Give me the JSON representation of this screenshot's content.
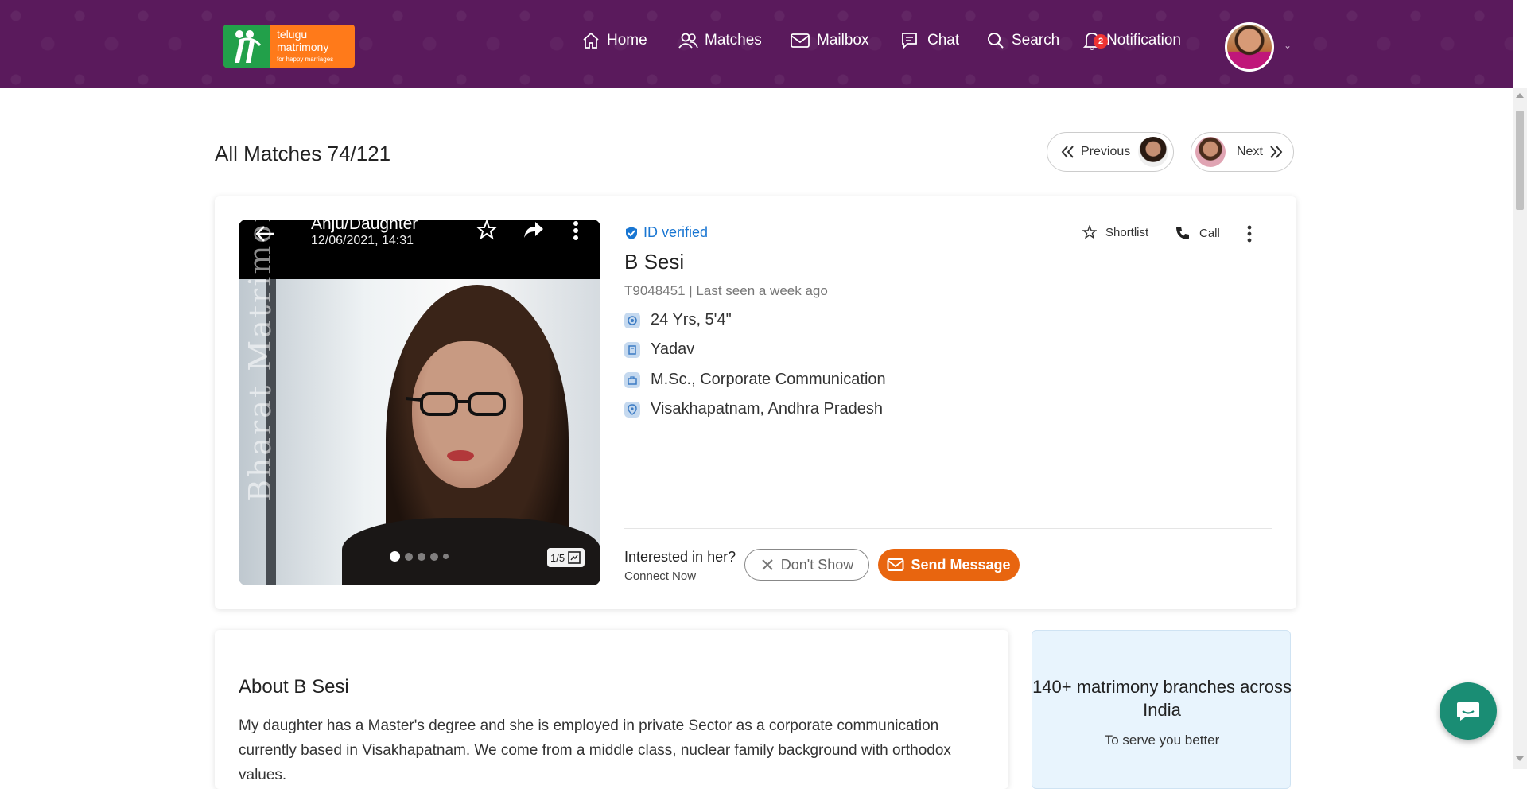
{
  "brand": {
    "line1": "telugu",
    "line2": "matrimony",
    "tagline": "for happy marriages"
  },
  "nav": {
    "home": "Home",
    "matches": "Matches",
    "mailbox": "Mailbox",
    "chat": "Chat",
    "search": "Search",
    "notification": "Notification",
    "notification_count": "2"
  },
  "page": {
    "title": "All Matches 74/121",
    "previous_label": "Previous",
    "next_label": "Next"
  },
  "profile": {
    "photo_title": "Anju/Daughter",
    "photo_date": "12/06/2021, 14:31",
    "watermark": "Bharat Matrimony.com",
    "photo_counter": "1/5",
    "verified_label": "ID verified",
    "name": "B Sesi",
    "meta": "T9048451 | Last seen a week ago",
    "age_height": "24 Yrs, 5'4\"",
    "caste": "Yadav",
    "education": "M.Sc., Corporate Communication",
    "location": "Visakhapatnam, Andhra Pradesh",
    "shortlist_label": "Shortlist",
    "call_label": "Call",
    "interest_question": "Interested in her?",
    "interest_sub": "Connect Now",
    "dont_show_label": "Don't Show",
    "send_message_label": "Send Message"
  },
  "about": {
    "title": "About B Sesi",
    "text": "My daughter has a Master's degree and she is employed in private Sector as a corporate communication currently based in Visakhapatnam. We come from a middle class, nuclear family background with orthodox values."
  },
  "branches": {
    "title": "140+ matrimony branches across India",
    "subtitle": "To serve you better"
  },
  "colors": {
    "header": "#5a1a5c",
    "accent_orange": "#e8650f",
    "verified_blue": "#1976d2",
    "chat_green": "#1a8d74"
  }
}
